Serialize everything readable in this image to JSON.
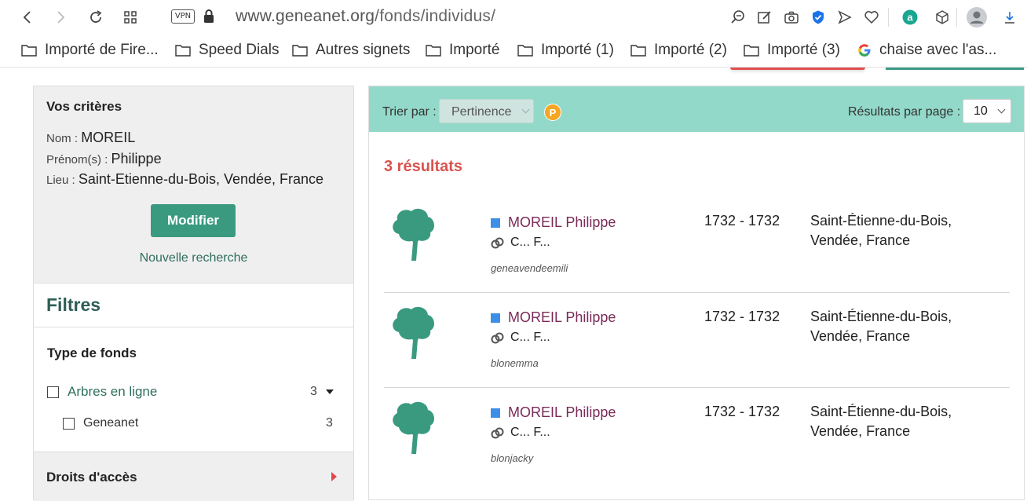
{
  "browser": {
    "vpn_label": "VPN",
    "url_host": "www.geneanet.org",
    "url_path": "/fonds/individus/"
  },
  "bookmarks": [
    {
      "label": "Importé de Fire..."
    },
    {
      "label": "Speed Dials"
    },
    {
      "label": "Autres signets"
    },
    {
      "label": "Importé"
    },
    {
      "label": "Importé (1)"
    },
    {
      "label": "Importé (2)"
    },
    {
      "label": "Importé (3)"
    },
    {
      "label": "chaise avec l'as..."
    }
  ],
  "criteria": {
    "title": "Vos critères",
    "nom_label": "Nom :",
    "nom_value": "MOREIL",
    "prenom_label": "Prénom(s) :",
    "prenom_value": "Philippe",
    "lieu_label": "Lieu :",
    "lieu_value": "Saint-Etienne-du-Bois, Vendée, France",
    "modify_button": "Modifier",
    "new_search": "Nouvelle recherche"
  },
  "filters": {
    "title": "Filtres",
    "type_title": "Type de fonds",
    "items": [
      {
        "label": "Arbres en ligne",
        "count": "3"
      },
      {
        "label": "Geneanet",
        "count": "3"
      }
    ],
    "droits_title": "Droits d'accès"
  },
  "toolbar": {
    "sort_label": "Trier par :",
    "sort_value": "Pertinence",
    "premium_badge": "P",
    "rpp_label": "Résultats par page :",
    "rpp_value": "10"
  },
  "results": {
    "count_text": "3 résultats",
    "items": [
      {
        "name": "MOREIL Philippe",
        "relations": "C... F...",
        "owner": "geneavendeemili",
        "dates": "1732 - 1732",
        "place_line1": "Saint-Étienne-du-Bois,",
        "place_line2": "Vendée, France"
      },
      {
        "name": "MOREIL Philippe",
        "relations": "C... F...",
        "owner": "blonemma",
        "dates": "1732 - 1732",
        "place_line1": "Saint-Étienne-du-Bois,",
        "place_line2": "Vendée, France"
      },
      {
        "name": "MOREIL Philippe",
        "relations": "C... F...",
        "owner": "blonjacky",
        "dates": "1732 - 1732",
        "place_line1": "Saint-Étienne-du-Bois,",
        "place_line2": "Vendée, France"
      }
    ]
  },
  "colors": {
    "accent": "#3a9a80",
    "sortbar": "#93d9c9",
    "result_count": "#d9534f",
    "name": "#7a2a57",
    "tree": "#3a9a80"
  }
}
